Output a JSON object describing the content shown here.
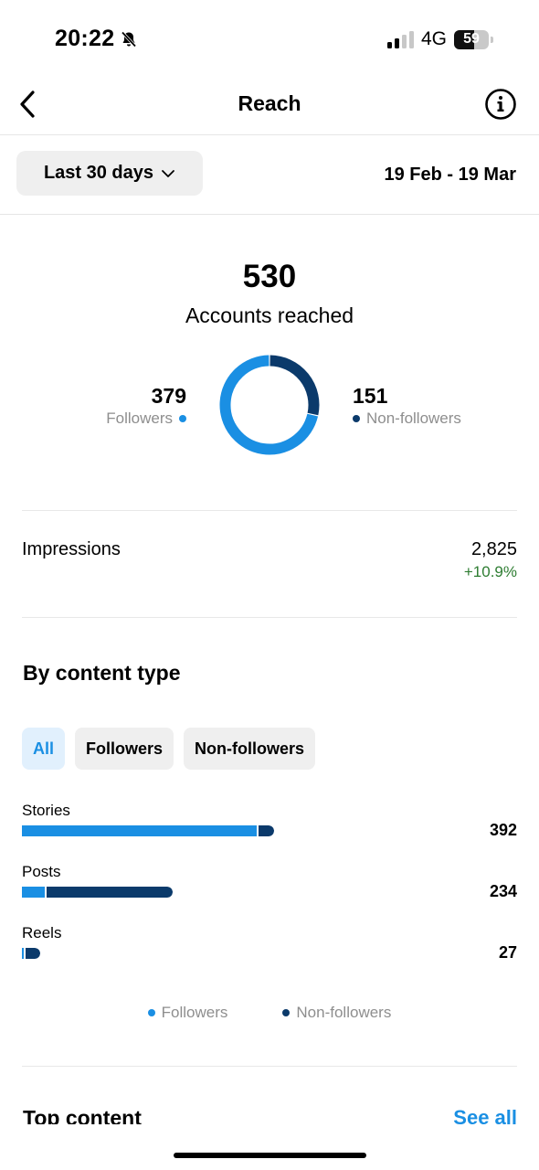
{
  "status_bar": {
    "time": "20:22",
    "network": "4G",
    "battery": "59",
    "battery_level": 0.59,
    "icons": [
      "bell-slash-icon",
      "signal-icon",
      "battery-icon"
    ]
  },
  "nav": {
    "title": "Reach",
    "icons": [
      "back-chevron-icon",
      "info-icon"
    ]
  },
  "filter": {
    "range_label": "Last 30 days",
    "date_range": "19 Feb - 19 Mar"
  },
  "reach": {
    "total": "530",
    "label": "Accounts reached",
    "followers_value": "379",
    "followers_label": "Followers",
    "nonfollowers_value": "151",
    "nonfollowers_label": "Non-followers"
  },
  "impressions": {
    "label": "Impressions",
    "value": "2,825",
    "change": "+10.9%"
  },
  "content_type": {
    "title": "By content type",
    "chips": [
      "All",
      "Followers",
      "Non-followers"
    ],
    "active_chip": "All"
  },
  "chart_data": {
    "type": "bar",
    "orientation": "horizontal",
    "stacked": true,
    "categories": [
      "Stories",
      "Posts",
      "Reels"
    ],
    "totals": [
      "392",
      "234",
      "27"
    ],
    "series": [
      {
        "name": "Followers",
        "values": [
          365,
          35,
          2
        ]
      },
      {
        "name": "Non-followers",
        "values": [
          27,
          199,
          25
        ]
      }
    ],
    "legend": [
      "Followers",
      "Non-followers"
    ],
    "legend_position": "bottom",
    "donut": {
      "type": "pie",
      "values": [
        379,
        151
      ],
      "labels": [
        "Followers",
        "Non-followers"
      ]
    }
  },
  "top_content": {
    "title": "Top content",
    "see_all": "See all"
  },
  "colors": {
    "followers": "#1a8fe3",
    "non_followers": "#0b3a6b",
    "positive_change": "#2e7d32",
    "secondary_text": "#8e8e8e",
    "link": "#1a8fe3"
  }
}
